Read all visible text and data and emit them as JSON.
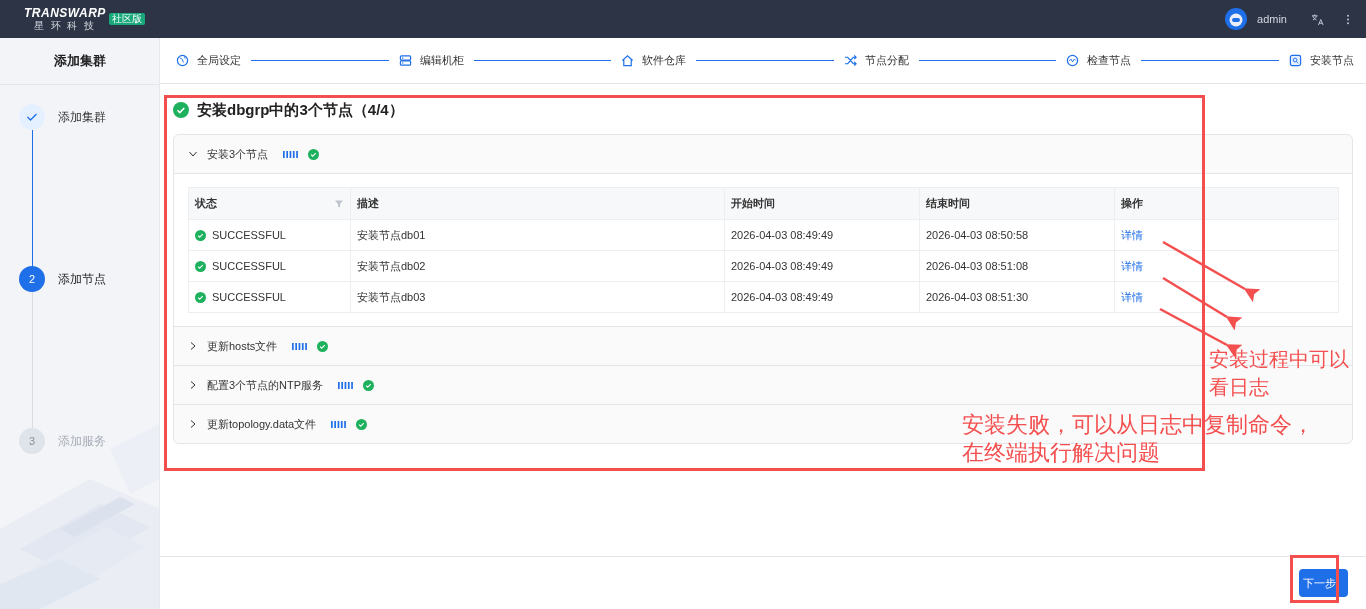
{
  "top_bar": {
    "logo": {
      "name": "TRANSWARP",
      "subtitle": "星 环 科 技",
      "badge": "社区版"
    },
    "user": "admin"
  },
  "sidebar": {
    "title": "添加集群",
    "steps": [
      {
        "label": "添加集群",
        "completed": true,
        "selected": false
      },
      {
        "label": "添加节点",
        "number": "2",
        "completed": false,
        "selected": true
      },
      {
        "label": "添加服务",
        "number": "3",
        "completed": false,
        "selected": false
      }
    ]
  },
  "step_bar": [
    {
      "label": "全局设定"
    },
    {
      "label": "编辑机柜"
    },
    {
      "label": "软件仓库"
    },
    {
      "label": "节点分配"
    },
    {
      "label": "检查节点"
    },
    {
      "label": "安装节点"
    }
  ],
  "task": {
    "title": "安装dbgrp中的3个节点（4/4）",
    "success": true
  },
  "panels": [
    {
      "label": "安装3个节点",
      "expanded": true,
      "success": true,
      "table": {
        "columns": [
          {
            "label": "状态",
            "filter": true
          },
          {
            "label": "描述",
            "filter": false
          },
          {
            "label": "开始时间",
            "filter": false
          },
          {
            "label": "结束时间",
            "filter": false
          },
          {
            "label": "操作",
            "filter": false
          }
        ],
        "rows": [
          {
            "status": "SUCCESSFUL",
            "description": "安装节点db01",
            "start": "2026-04-03 08:49:49",
            "end": "2026-04-03 08:50:58",
            "action": "详情"
          },
          {
            "status": "SUCCESSFUL",
            "description": "安装节点db02",
            "start": "2026-04-03 08:49:49",
            "end": "2026-04-03 08:51:08",
            "action": "详情"
          },
          {
            "status": "SUCCESSFUL",
            "description": "安装节点db03",
            "start": "2026-04-03 08:49:49",
            "end": "2026-04-03 08:51:30",
            "action": "详情"
          }
        ]
      }
    },
    {
      "label": "更新hosts文件",
      "expanded": false,
      "success": true
    },
    {
      "label": "配置3个节点的NTP服务",
      "expanded": false,
      "success": true
    },
    {
      "label": "更新topology.data文件",
      "expanded": false,
      "success": true
    }
  ],
  "footer": {
    "next_button": "下一步"
  },
  "annotations": [
    {
      "text": "安装过程中可以看日志"
    },
    {
      "text": "安装失败，可以从日志中复制命令，在终端执行解决问题"
    }
  ]
}
